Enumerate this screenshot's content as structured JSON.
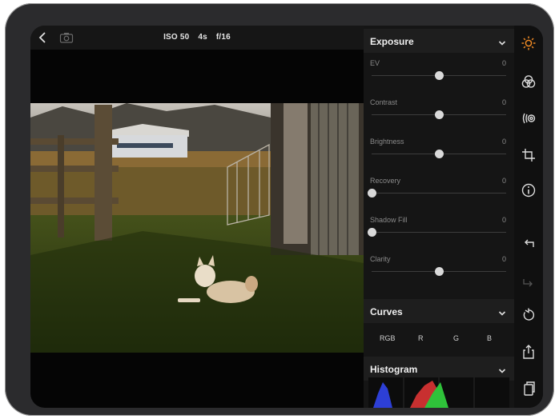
{
  "topbar": {
    "iso": "ISO 50",
    "shutter": "4s",
    "aperture": "f/16"
  },
  "exposure": {
    "title": "Exposure",
    "sliders": [
      {
        "label": "EV",
        "value": "0",
        "position": 0.5
      },
      {
        "label": "Contrast",
        "value": "0",
        "position": 0.5
      },
      {
        "label": "Brightness",
        "value": "0",
        "position": 0.5
      },
      {
        "label": "Recovery",
        "value": "0",
        "position": 0.0
      },
      {
        "label": "Shadow Fill",
        "value": "0",
        "position": 0.0
      },
      {
        "label": "Clarity",
        "value": "0",
        "position": 0.5
      }
    ]
  },
  "curves": {
    "title": "Curves",
    "channels": [
      "RGB",
      "R",
      "G",
      "B"
    ]
  },
  "histogram": {
    "title": "Histogram"
  },
  "colors": {
    "accent": "#f08a24",
    "panel": "#151515",
    "toolbar": "#101010"
  },
  "toolbar_icons": [
    "sun-icon",
    "color-palette-icon",
    "lens-icon",
    "crop-icon",
    "info-icon",
    "undo-icon",
    "redo-icon",
    "reset-icon",
    "share-icon",
    "copy-icon"
  ]
}
